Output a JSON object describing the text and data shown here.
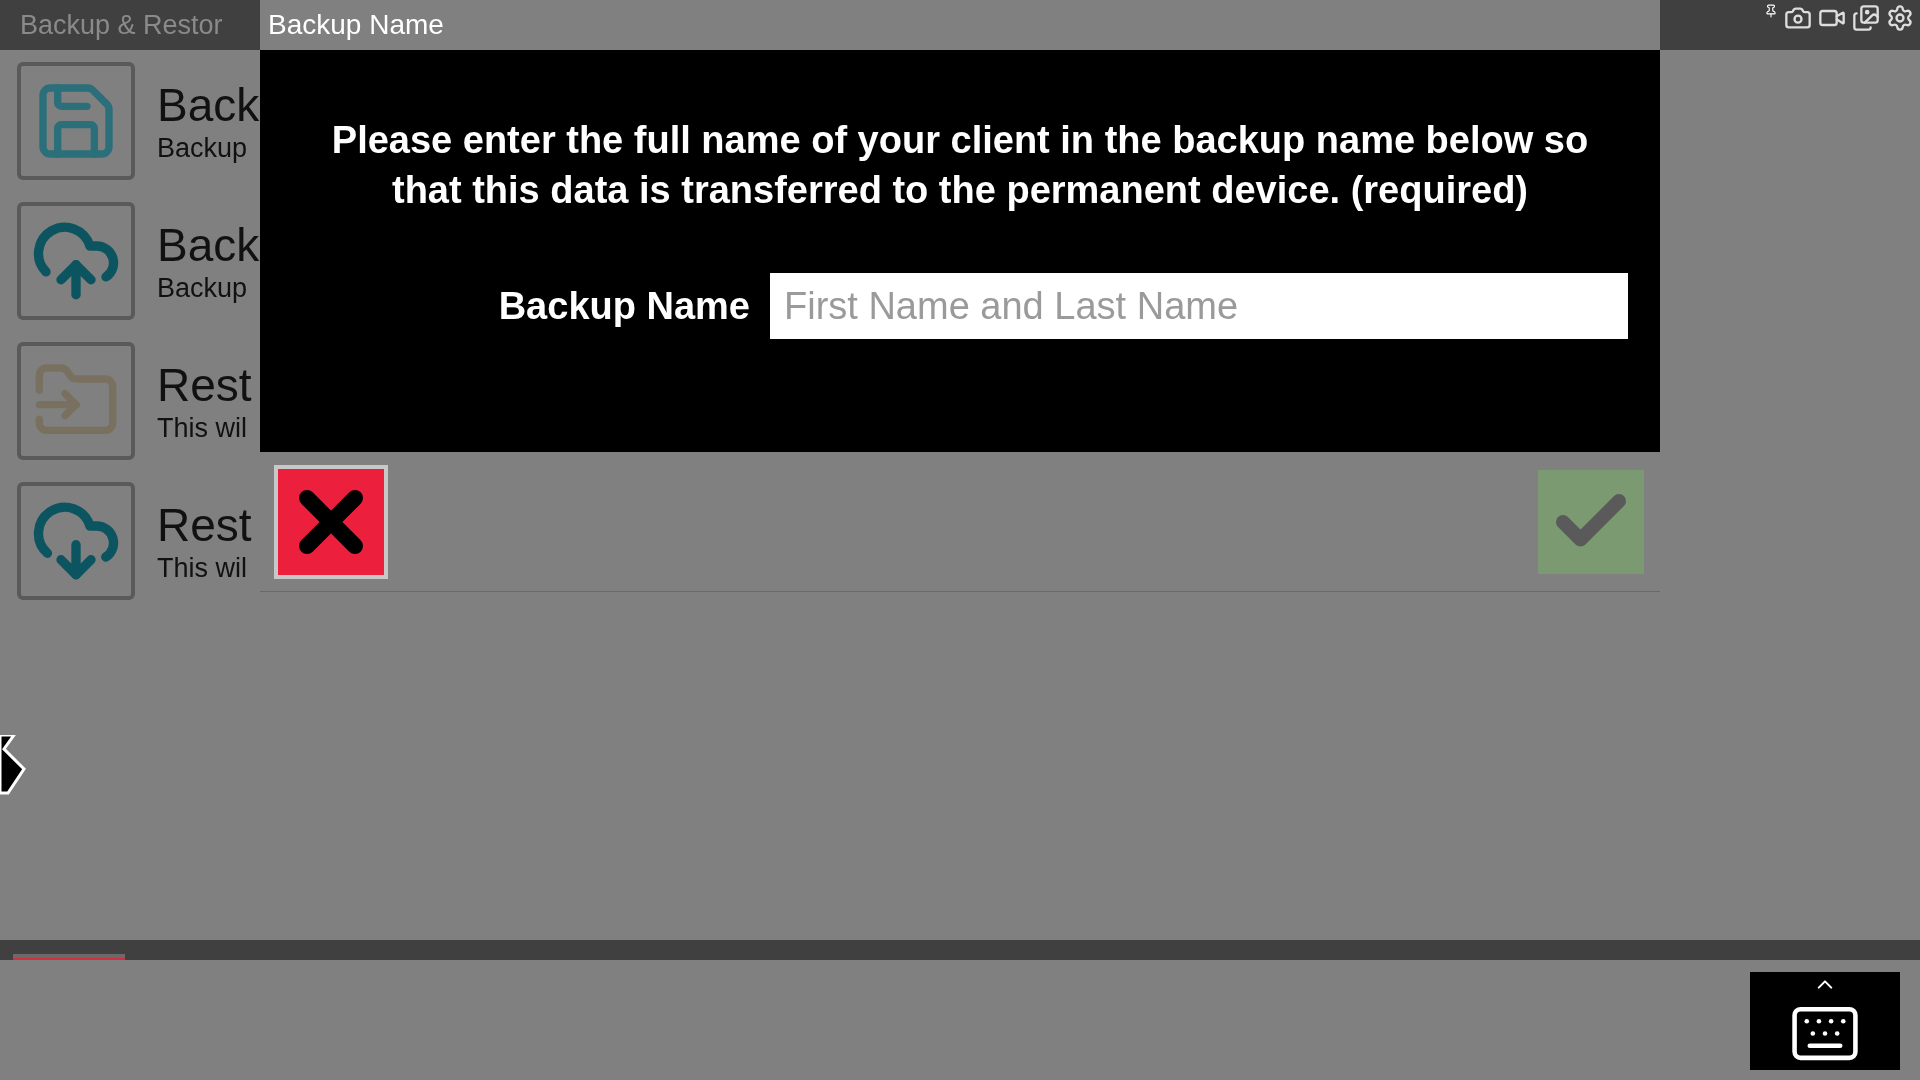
{
  "app_bar": {
    "title": "Backup & Restor"
  },
  "options": [
    {
      "kind": "floppy",
      "title": "Back",
      "subtitle": "Backup"
    },
    {
      "kind": "upload",
      "title": "Back",
      "subtitle": "Backup"
    },
    {
      "kind": "folder",
      "title": "Rest",
      "subtitle": "This wil"
    },
    {
      "kind": "download",
      "title": "Rest",
      "subtitle": "This wil"
    }
  ],
  "dialog": {
    "title": "Backup Name",
    "message": "Please enter the full name of your client in the backup name below so that this data is transferred to the permanent device. (required)",
    "field": {
      "label": "Backup Name",
      "placeholder": "First Name and Last Name"
    },
    "buttons": [
      {
        "kind": "cancel",
        "disabled": false
      },
      {
        "kind": "confirm",
        "disabled": true
      }
    ]
  }
}
